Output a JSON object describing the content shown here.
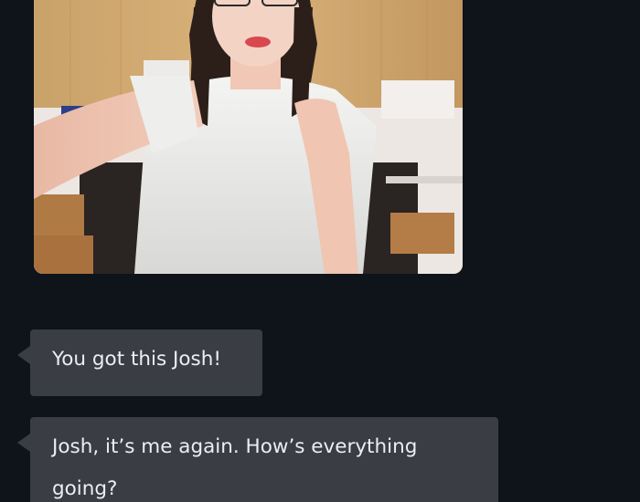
{
  "chat": {
    "image_message": {
      "description_icon": "photo-image"
    },
    "messages": [
      {
        "text": "You got this Josh!"
      },
      {
        "text": "Josh, it’s me again. How’s everything going?"
      }
    ]
  },
  "colors": {
    "background": "#0f131a",
    "bubble": "#3a3d44",
    "bubble_text": "#eceef2"
  }
}
